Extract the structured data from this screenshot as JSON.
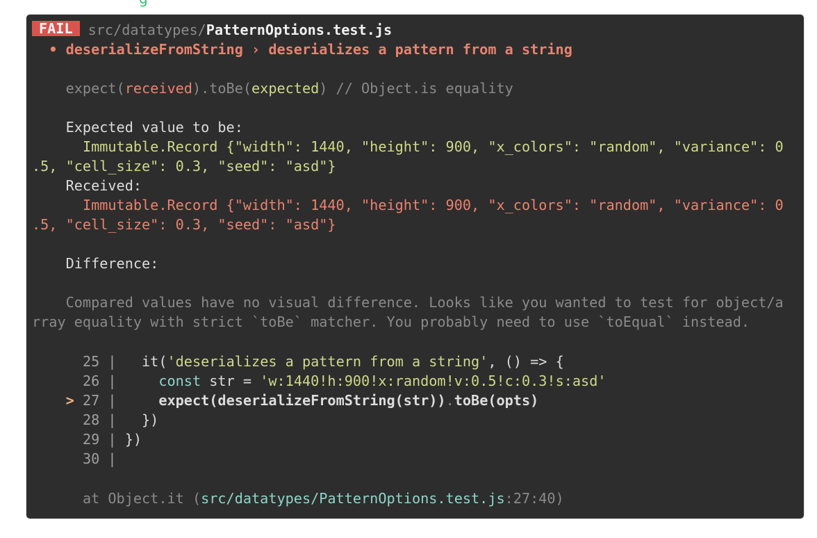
{
  "header_fragment": "g",
  "fail": {
    "badge": "FAIL",
    "path_dir": "src/datatypes/",
    "path_file": "PatternOptions.test.js"
  },
  "title": {
    "bullet": "•",
    "suite": "deserializeFromString",
    "separator": "›",
    "test": "deserializes a pattern from a string"
  },
  "assertion": {
    "prefix": "expect(",
    "received": "received",
    "middle": ").toBe(",
    "expected": "expected",
    "suffix": ") // Object.is equality"
  },
  "expected_label": "Expected value to be:",
  "expected_line1": "Immutable.Record {\"width\": 1440, \"height\": 900, \"x_colors\": \"random\", \"variance\": 0",
  "expected_line2": ".5, \"cell_size\": 0.3, \"seed\": \"asd\"}",
  "received_label": "Received:",
  "received_line1": "Immutable.Record {\"width\": 1440, \"height\": 900, \"x_colors\": \"random\", \"variance\": 0",
  "received_line2": ".5, \"cell_size\": 0.3, \"seed\": \"asd\"}",
  "difference_label": "Difference:",
  "hint_line1": "Compared values have no visual difference. Looks like you wanted to test for object/a",
  "hint_line2": "rray equality with strict `toBe` matcher. You probably need to use `toEqual` instead.",
  "code": {
    "l25": {
      "num": "25",
      "sep": "|",
      "it": "it(",
      "str": "'deserializes a pattern from a string'",
      "comma": ", ",
      "arrow": "() => {"
    },
    "l26": {
      "num": "26",
      "sep": "|",
      "kw": "const",
      "name": " str = ",
      "str": "'w:1440!h:900!x:random!v:0.5!c:0.3!s:asd'"
    },
    "l27": {
      "marker": ">",
      "num": "27",
      "sep": "|",
      "a": "expect(deserializeFromString(str))",
      "dot": ".",
      "b": "toBe(opts)"
    },
    "l28": {
      "num": "28",
      "sep": "|",
      "text": "})"
    },
    "l29": {
      "num": "29",
      "sep": "|",
      "text": "})"
    },
    "l30": {
      "num": "30",
      "sep": "|"
    }
  },
  "stack": {
    "prefix": "at Object.it (",
    "path": "src/datatypes/PatternOptions.test.js",
    "loc": ":27:40",
    "suffix": ")"
  }
}
